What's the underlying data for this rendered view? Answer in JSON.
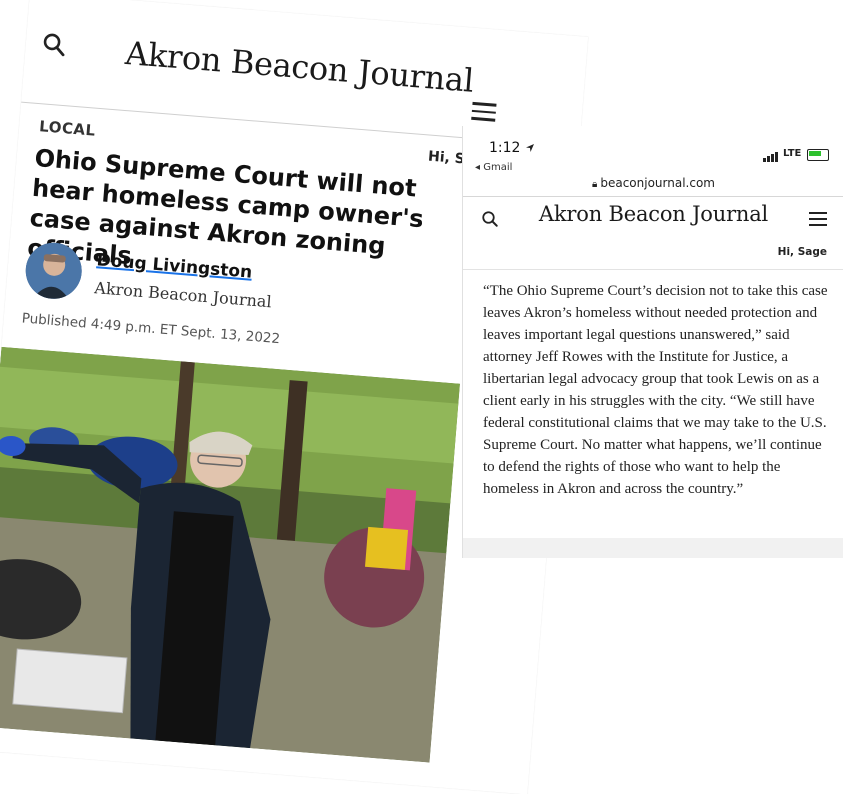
{
  "left_article": {
    "masthead": "Akron Beacon Journal",
    "section": "LOCAL",
    "greeting": "Hi, Sa",
    "headline": "Ohio Supreme Court will not hear homeless camp owner's case against Akron zoning officials",
    "author": "Doug Livingston",
    "outlet": "Akron Beacon Journal",
    "published": "Published 4:49 p.m. ET Sept. 13, 2022"
  },
  "right_article": {
    "status": {
      "time": "1:12",
      "back": "◂ Gmail",
      "network": "LTE"
    },
    "url": "beaconjournal.com",
    "masthead": "Akron Beacon Journal",
    "greeting": "Hi, Sage",
    "quote": "“The Ohio Supreme Court’s decision not to take this case leaves Akron’s homeless without needed protection and leaves important legal questions unanswered,” said attorney Jeff Rowes with the Institute for Justice, a libertarian legal advocacy group that took Lewis on as a client early in his struggles with the city. “We still have federal constitutional claims that we may take to the U.S. Supreme Court. No matter what happens, we’ll continue to defend the rights of those who want to help the homeless in Akron and across the country.”"
  },
  "icons": {
    "search": "search-icon",
    "menu": "hamburger-menu-icon",
    "lock": "lock-icon",
    "location": "location-arrow-icon",
    "battery": "battery-charging-icon",
    "signal": "cell-signal-icon"
  },
  "colors": {
    "author_underline": "#1a73e8",
    "battery": "#2ec12e"
  }
}
